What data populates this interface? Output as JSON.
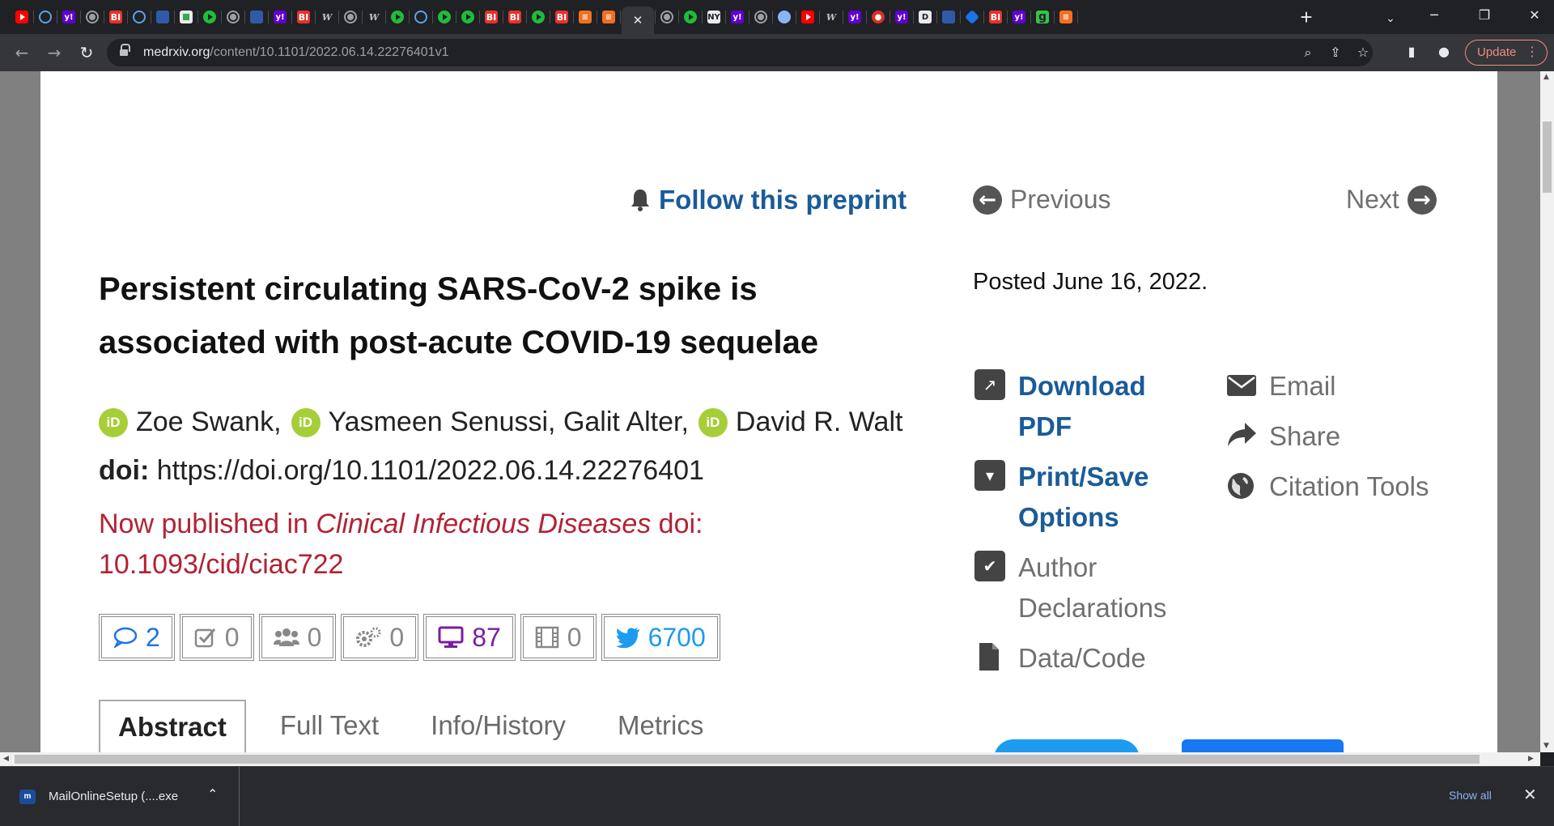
{
  "browser": {
    "tabs": [
      {
        "icon": "youtube-icon",
        "cls": "yt",
        "glyph": ""
      },
      {
        "icon": "crescent-icon",
        "cls": "moon",
        "glyph": ""
      },
      {
        "icon": "yahoo-icon",
        "cls": "yahoo",
        "glyph": "y!"
      },
      {
        "icon": "globe-icon",
        "cls": "globe",
        "glyph": ""
      },
      {
        "icon": "business-insider-icon",
        "cls": "bi",
        "glyph": "BI"
      },
      {
        "icon": "crescent-icon",
        "cls": "moon",
        "glyph": ""
      },
      {
        "icon": "flag-icon",
        "cls": "flag",
        "glyph": ""
      },
      {
        "icon": "map-icon",
        "cls": "grid",
        "glyph": ""
      },
      {
        "icon": "play-icon",
        "cls": "play",
        "glyph": ""
      },
      {
        "icon": "globe-icon",
        "cls": "globe",
        "glyph": ""
      },
      {
        "icon": "flag-icon",
        "cls": "flag",
        "glyph": ""
      },
      {
        "icon": "yahoo-icon",
        "cls": "yahoo",
        "glyph": "y!"
      },
      {
        "icon": "business-insider-icon",
        "cls": "bi",
        "glyph": "BI"
      },
      {
        "icon": "wsj-icon",
        "cls": "wsj",
        "glyph": "W"
      },
      {
        "icon": "globe-icon",
        "cls": "globe",
        "glyph": ""
      },
      {
        "icon": "wsj-icon",
        "cls": "wsj",
        "glyph": "W"
      },
      {
        "icon": "play-icon",
        "cls": "play",
        "glyph": ""
      },
      {
        "icon": "crescent-icon",
        "cls": "moon",
        "glyph": ""
      },
      {
        "icon": "play-icon",
        "cls": "play",
        "glyph": ""
      },
      {
        "icon": "play-icon",
        "cls": "play",
        "glyph": ""
      },
      {
        "icon": "business-insider-icon",
        "cls": "bi",
        "glyph": "BI"
      },
      {
        "icon": "business-insider-icon",
        "cls": "bi",
        "glyph": "BI"
      },
      {
        "icon": "play-icon",
        "cls": "play",
        "glyph": ""
      },
      {
        "icon": "business-insider-icon",
        "cls": "bi",
        "glyph": "BI"
      },
      {
        "icon": "substack-icon",
        "cls": "rss",
        "glyph": "≡"
      },
      {
        "icon": "substack-icon",
        "cls": "rss",
        "glyph": "≡"
      },
      {
        "icon": "close-icon",
        "cls": "",
        "glyph": "✕",
        "active": true
      },
      {
        "icon": "globe-icon",
        "cls": "globe",
        "glyph": ""
      },
      {
        "icon": "play-icon",
        "cls": "play",
        "glyph": ""
      },
      {
        "icon": "news-icon",
        "cls": "box",
        "glyph": "NY"
      },
      {
        "icon": "yahoo-icon",
        "cls": "yahoo",
        "glyph": "y!"
      },
      {
        "icon": "globe-icon",
        "cls": "globe",
        "glyph": ""
      },
      {
        "icon": "avatar-icon",
        "cls": "face",
        "glyph": ""
      },
      {
        "icon": "youtube-icon",
        "cls": "yt",
        "glyph": ""
      },
      {
        "icon": "wsj-icon",
        "cls": "wsj",
        "glyph": "W"
      },
      {
        "icon": "yahoo-icon",
        "cls": "yahoo",
        "glyph": "y!"
      },
      {
        "icon": "podcast-icon",
        "cls": "red",
        "glyph": "●"
      },
      {
        "icon": "yahoo-icon",
        "cls": "yahoo",
        "glyph": "y!"
      },
      {
        "icon": "bookmark-icon",
        "cls": "box",
        "glyph": "D"
      },
      {
        "icon": "flag-icon",
        "cls": "flag",
        "glyph": ""
      },
      {
        "icon": "cube-icon",
        "cls": "hex",
        "glyph": ""
      },
      {
        "icon": "business-insider-icon",
        "cls": "bi",
        "glyph": "BI"
      },
      {
        "icon": "yahoo-icon",
        "cls": "yahoo",
        "glyph": "y!"
      },
      {
        "icon": "g-icon",
        "cls": "g",
        "glyph": "g"
      },
      {
        "icon": "substack-icon",
        "cls": "rss",
        "glyph": "≡"
      }
    ],
    "url_host": "medrxiv.org",
    "url_path": "/content/10.1101/2022.06.14.22276401v1",
    "update_label": "Update"
  },
  "article": {
    "follow_label": "Follow this preprint",
    "previous_label": "Previous",
    "next_label": "Next",
    "title": "Persistent circulating SARS-CoV-2 spike is associated with post-acute COVID-19 sequelae",
    "posted": "Posted June 16, 2022.",
    "authors": [
      {
        "name": "Zoe Swank,",
        "orcid": true
      },
      {
        "name": "Yasmeen Senussi, Galit Alter,",
        "orcid": true
      },
      {
        "name": "David R. Walt",
        "orcid": true
      }
    ],
    "orcid_badge": "iD",
    "doi_label": "doi:",
    "doi_value": "https://doi.org/10.1101/2022.06.14.22276401",
    "published_prefix": "Now published in ",
    "published_journal": "Clinical Infectious Diseases",
    "published_suffix": " doi: 10.1093/cid/ciac722",
    "metrics": [
      {
        "key": "comments",
        "value": "2",
        "icon": "comment-icon",
        "style": "blue"
      },
      {
        "key": "reviews",
        "value": "0",
        "icon": "checkbox-icon",
        "style": ""
      },
      {
        "key": "community",
        "value": "0",
        "icon": "users-icon",
        "style": ""
      },
      {
        "key": "automated",
        "value": "0",
        "icon": "gears-icon",
        "style": ""
      },
      {
        "key": "media",
        "value": "87",
        "icon": "monitor-icon",
        "style": "purple"
      },
      {
        "key": "video",
        "value": "0",
        "icon": "film-icon",
        "style": ""
      },
      {
        "key": "twitter",
        "value": "6700",
        "icon": "twitter-icon",
        "style": "tw"
      }
    ],
    "tabs": [
      "Abstract",
      "Full Text",
      "Info/History",
      "Metrics"
    ],
    "active_tab": "Abstract"
  },
  "sidebar": {
    "download_pdf": "Download PDF",
    "print_save": "Print/Save Options",
    "author_declarations": "Author Declarations",
    "data_code": "Data/Code",
    "email": "Email",
    "share": "Share",
    "citation_tools": "Citation Tools"
  },
  "downloads": {
    "file_name": "MailOnlineSetup (....exe",
    "show_all": "Show all"
  },
  "colors": {
    "link": "#1a5b99",
    "published": "#b22234",
    "orcid": "#a6ce39",
    "twitter": "#1d9bf0"
  }
}
